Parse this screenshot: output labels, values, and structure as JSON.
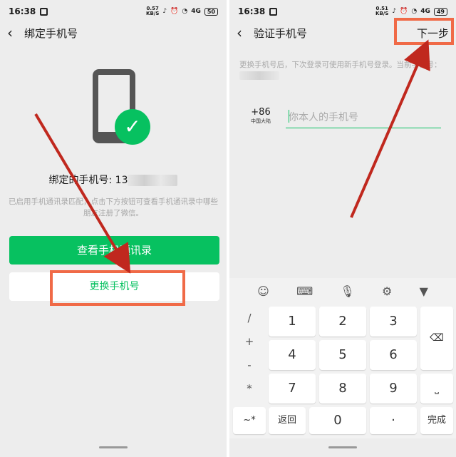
{
  "left": {
    "status": {
      "time": "16:38",
      "speed": "0.57",
      "speed_unit": "KB/S",
      "network": "4G",
      "battery": "50"
    },
    "title": "绑定手机号",
    "bound_label": "绑定的手机号: 13",
    "hint": "已启用手机通讯录匹配，点击下方按钮可查看手机通讯录中哪些朋友注册了微信。",
    "view_contacts_button": "查看手机通讯录",
    "change_phone_button": "更换手机号"
  },
  "right": {
    "status": {
      "time": "16:38",
      "speed": "0.51",
      "speed_unit": "KB/S",
      "network": "4G",
      "battery": "49"
    },
    "title": "验证手机号",
    "next_button": "下一步",
    "hint": "更换手机号后，下次登录可使用新手机号登录。当前手机号：",
    "country_code": "+86",
    "region": "中国大陆",
    "phone_placeholder": "你本人的手机号",
    "keyboard": {
      "toolbar": [
        "emoji-icon",
        "keyboard-icon",
        "mic-icon",
        "settings-icon",
        "collapse-icon"
      ],
      "symbols": [
        "/",
        "+",
        "-",
        "*"
      ],
      "keys": [
        "1",
        "2",
        "3",
        "4",
        "5",
        "6",
        "7",
        "8",
        "9"
      ],
      "back": "返回",
      "zero": "0",
      "dot": "·",
      "done": "完成",
      "symbol_switch": "~*"
    }
  },
  "colors": {
    "accent": "#07c160",
    "annotation": "#f06a47",
    "arrow": "#c0281e"
  }
}
